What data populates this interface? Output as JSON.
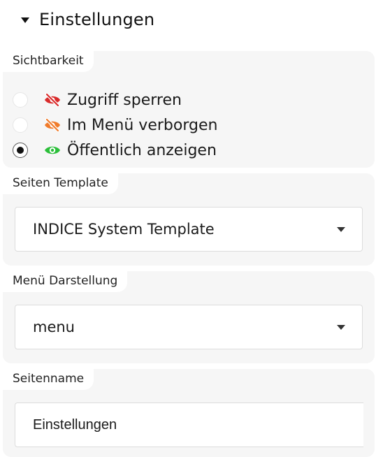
{
  "section": {
    "title": "Einstellungen",
    "expanded_icon": "caret-down-icon"
  },
  "visibility": {
    "label": "Sichtbarkeit",
    "options": [
      {
        "label": "Zugriff sperren",
        "icon": "eye-slash-icon",
        "icon_color": "#d92b2b",
        "selected": false
      },
      {
        "label": "Im Menü verborgen",
        "icon": "eye-slash-icon",
        "icon_color": "#f07b2a",
        "selected": false
      },
      {
        "label": "Öffentlich anzeigen",
        "icon": "eye-icon",
        "icon_color": "#2bbf3a",
        "selected": true
      }
    ]
  },
  "template": {
    "label": "Seiten Template",
    "value": "INDICE System Template"
  },
  "menu": {
    "label": "Menü Darstellung",
    "value": "menu"
  },
  "page_name": {
    "label": "Seitenname",
    "value": "Einstellungen"
  }
}
